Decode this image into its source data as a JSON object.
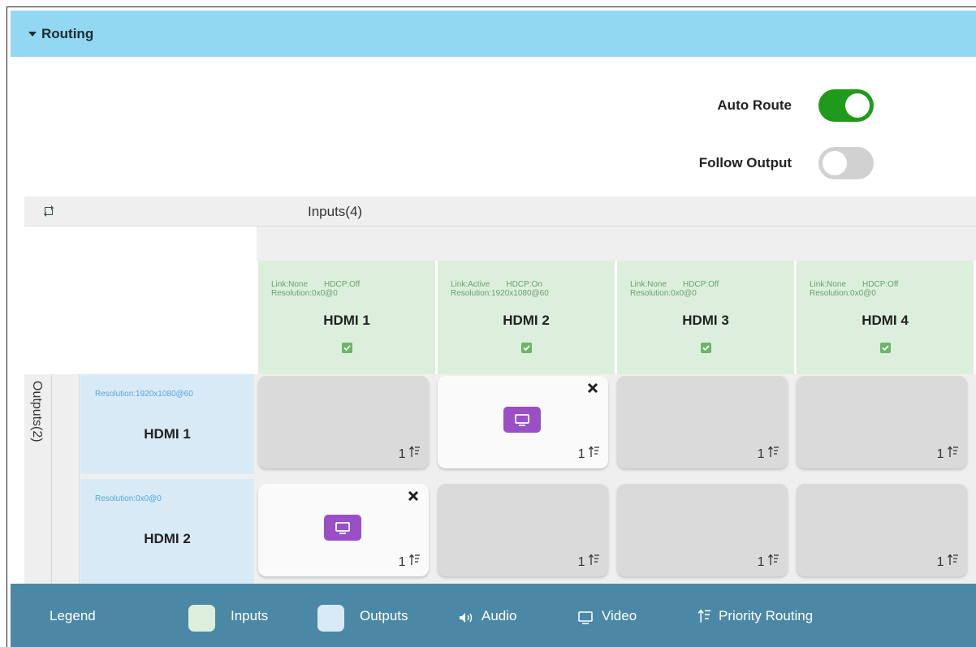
{
  "section": {
    "title": "Routing",
    "expanded": true
  },
  "auto_route": {
    "label": "Auto Route",
    "enabled": true
  },
  "follow_output": {
    "label": "Follow Output",
    "enabled": false
  },
  "grid": {
    "inputs_title": "Inputs(4)",
    "outputs_title": "Outputs(2)",
    "inputs": [
      {
        "link": "Link:None",
        "hdcp": "HDCP:Off",
        "resolution": "Resolution:0x0@0",
        "name": "HDMI 1",
        "checked": true
      },
      {
        "link": "Link:Active",
        "hdcp": "HDCP:On",
        "resolution": "Resolution:1920x1080@60",
        "name": "HDMI 2",
        "checked": true
      },
      {
        "link": "Link:None",
        "hdcp": "HDCP:Off",
        "resolution": "Resolution:0x0@0",
        "name": "HDMI 3",
        "checked": true
      },
      {
        "link": "Link:None",
        "hdcp": "HDCP:Off",
        "resolution": "Resolution:0x0@0",
        "name": "HDMI 4",
        "checked": true
      }
    ],
    "outputs": [
      {
        "resolution": "Resolution:1920x1080@60",
        "name": "HDMI 1",
        "cells": [
          {
            "routed": false,
            "priority": "1"
          },
          {
            "routed": true,
            "priority": "1"
          },
          {
            "routed": false,
            "priority": "1"
          },
          {
            "routed": false,
            "priority": "1"
          }
        ]
      },
      {
        "resolution": "Resolution:0x0@0",
        "name": "HDMI 2",
        "cells": [
          {
            "routed": true,
            "priority": "1"
          },
          {
            "routed": false,
            "priority": "1"
          },
          {
            "routed": false,
            "priority": "1"
          },
          {
            "routed": false,
            "priority": "1"
          }
        ]
      }
    ]
  },
  "legend": {
    "label": "Legend",
    "inputs": "Inputs",
    "outputs": "Outputs",
    "audio": "Audio",
    "video": "Video",
    "priority": "Priority Routing"
  },
  "colors": {
    "header_bg": "#93d8f3",
    "toggle_on": "#1f9a1a",
    "toggle_off": "#d1d1d1",
    "input_bg": "#dcefdc",
    "output_bg": "#d9eaf7",
    "video_badge": "#9a4fc6",
    "legend_bg": "#4a88a6"
  },
  "icons": [
    "caret-down-icon",
    "refresh-icon",
    "checkbox-icon",
    "close-icon",
    "video-icon",
    "priority-routing-icon",
    "audio-icon"
  ]
}
